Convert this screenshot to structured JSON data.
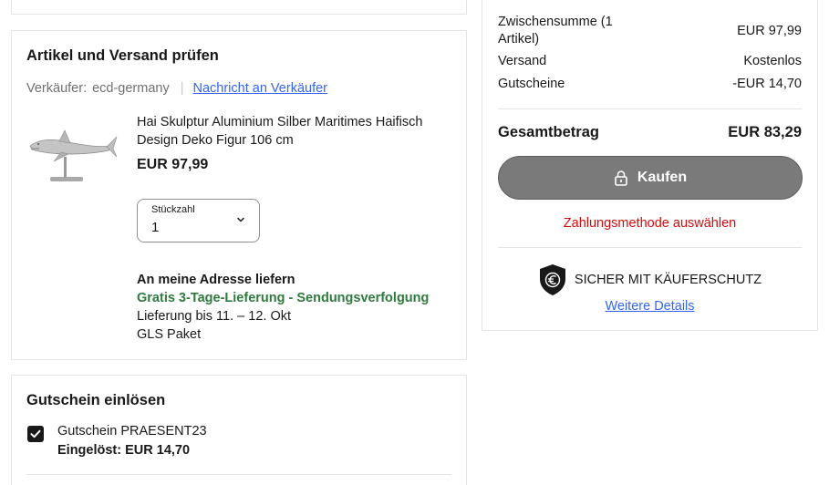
{
  "item_section": {
    "title": "Artikel und Versand prüfen",
    "seller_label": "Verkäufer:",
    "seller_name": "ecd-germany",
    "separator": "|",
    "contact_link": "Nachricht an Verkäufer",
    "product_name": "Hai Skulptur Aluminium Silber Maritimes Haifisch Design Deko Figur 106 cm",
    "price": "EUR 97,99",
    "quantity_label": "Stückzahl",
    "quantity_value": "1",
    "shipping": {
      "heading": "An meine Adresse liefern",
      "option": "Gratis 3-Tage-Lieferung - Sendungsverfolgung",
      "delivery": "Lieferung bis 11. – 12. Okt",
      "carrier": "GLS Paket"
    }
  },
  "coupon_section": {
    "title": "Gutschein einlösen",
    "coupon_name": "Gutschein PRAESENT23",
    "redeemed": "Eingelöst: EUR 14,70",
    "checked": true
  },
  "summary": {
    "subtotal_label": "Zwischensumme (1 Artikel)",
    "subtotal_value": "EUR 97,99",
    "shipping_label": "Versand",
    "shipping_value": "Kostenlos",
    "coupon_label": "Gutscheine",
    "coupon_value": "-EUR 14,70",
    "total_label": "Gesamtbetrag",
    "total_value": "EUR 83,29",
    "buy_button": "Kaufen",
    "payment_prompt": "Zahlungsmethode auswählen",
    "protection_text": "SICHER MIT KÄUFERSCHUTZ",
    "details_link": "Weitere Details"
  },
  "colors": {
    "link": "#3665f3",
    "shipping_green": "#2f7a3d",
    "error_red": "#d50b0b",
    "buy_button_bg": "#7a7a7a"
  },
  "icons": {
    "quantity_dropdown": "chevron-down-icon",
    "buy_button": "lock-icon",
    "buyer_protection": "shield-euro-icon",
    "coupon_checkbox": "checkmark-icon"
  }
}
